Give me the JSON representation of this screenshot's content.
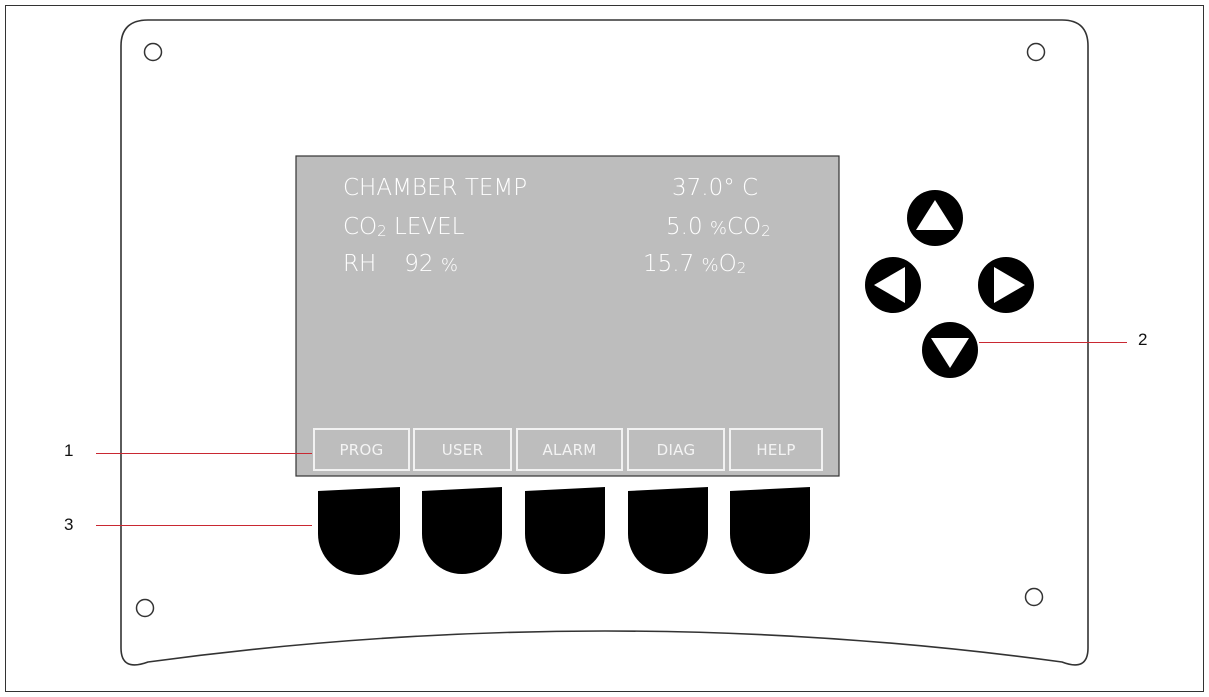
{
  "display": {
    "row1": {
      "left": "CHAMBER TEMP",
      "right": "37.0° C"
    },
    "row2": {
      "left_main": "CO",
      "left_sub": "2",
      "left_rest": " LEVEL",
      "right_value": "5.0 ",
      "right_pct": "%",
      "right_gas": "CO",
      "right_sub": "2"
    },
    "row3": {
      "left_label": "RH",
      "left_value": "92",
      "left_pct": "%",
      "right_value": "15.7 ",
      "right_pct": "%",
      "right_gas": "O",
      "right_sub": "2"
    }
  },
  "softkeys": [
    "PROG",
    "USER",
    "ALARM",
    "DIAG",
    "HELP"
  ],
  "callouts": {
    "one": "1",
    "two": "2",
    "three": "3"
  },
  "colors": {
    "panel_outline": "#333333",
    "screen": "#bdbdbd",
    "screen_text": "#ffffff",
    "keys": "#000000",
    "callout_lines": "#c92832"
  },
  "icons": {
    "nav_up": "triangle-up-icon",
    "nav_down": "triangle-down-icon",
    "nav_left": "triangle-left-icon",
    "nav_right": "triangle-right-icon"
  }
}
